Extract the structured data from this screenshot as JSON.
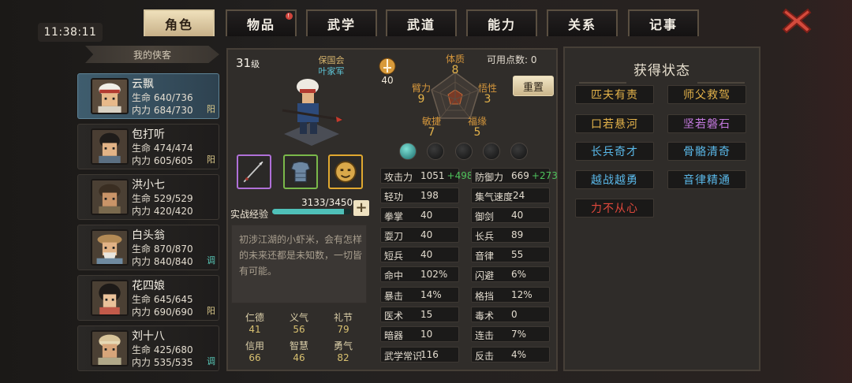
{
  "clock": "11:38:11",
  "tabs": [
    {
      "label": "角色",
      "active": true
    },
    {
      "label": "物品",
      "badge": "!"
    },
    {
      "label": "武学"
    },
    {
      "label": "武道"
    },
    {
      "label": "能力"
    },
    {
      "label": "关系"
    },
    {
      "label": "记事"
    }
  ],
  "roster_title": "我的侠客",
  "heroes": [
    {
      "name": "云飘",
      "hp": "生命 640/736",
      "mp": "内力 684/730",
      "tag": "阳",
      "selected": true
    },
    {
      "name": "包打听",
      "hp": "生命 474/474",
      "mp": "内力 605/605",
      "tag": "阳"
    },
    {
      "name": "洪小七",
      "hp": "生命 529/529",
      "mp": "内力 420/420",
      "tag": ""
    },
    {
      "name": "白头翁",
      "hp": "生命 870/870",
      "mp": "内力 840/840",
      "tag": "调"
    },
    {
      "name": "花四娘",
      "hp": "生命 645/645",
      "mp": "内力 690/690",
      "tag": "阳"
    },
    {
      "name": "刘十八",
      "hp": "生命 425/680",
      "mp": "内力 535/535",
      "tag": "调"
    }
  ],
  "character": {
    "level": "31",
    "level_unit": "级",
    "faction": "保国会",
    "sub_faction": "叶家军",
    "sword_value": "40",
    "exp_label": "实战经验",
    "exp_value": "3133/3450",
    "exp_fraction": 0.908,
    "description": "初涉江湖的小虾米，会有怎样的未来还都是未知数，一切皆有可能。"
  },
  "attributes": {
    "physique": {
      "label": "体质",
      "value": "8"
    },
    "arm": {
      "label": "臂力",
      "value": "9"
    },
    "nature": {
      "label": "悟性",
      "value": "3"
    },
    "agility": {
      "label": "敏捷",
      "value": "7"
    },
    "fortune": {
      "label": "福缘",
      "value": "5"
    }
  },
  "points_label": "可用点数: 0",
  "reset_label": "重置",
  "virtues": [
    {
      "label": "仁德",
      "value": "41"
    },
    {
      "label": "义气",
      "value": "56"
    },
    {
      "label": "礼节",
      "value": "79"
    },
    {
      "label": "信用",
      "value": "66"
    },
    {
      "label": "智慧",
      "value": "46"
    },
    {
      "label": "勇气",
      "value": "82"
    }
  ],
  "stats_left": [
    {
      "label": "攻击力",
      "value": "1051",
      "bonus": "+498"
    },
    {
      "label": "轻功",
      "value": "198"
    },
    {
      "label": "拳掌",
      "value": "40"
    },
    {
      "label": "耍刀",
      "value": "40"
    },
    {
      "label": "短兵",
      "value": "40"
    },
    {
      "label": "命中",
      "value": "102%"
    },
    {
      "label": "暴击",
      "value": "14%"
    },
    {
      "label": "医术",
      "value": "15"
    },
    {
      "label": "暗器",
      "value": "10"
    },
    {
      "label": "武学常识",
      "value": "116"
    }
  ],
  "stats_right": [
    {
      "label": "防御力",
      "value": "669",
      "bonus": "+273"
    },
    {
      "label": "集气速度",
      "value": "24"
    },
    {
      "label": "御剑",
      "value": "40"
    },
    {
      "label": "长兵",
      "value": "89"
    },
    {
      "label": "音律",
      "value": "55"
    },
    {
      "label": "闪避",
      "value": "6%"
    },
    {
      "label": "格挡",
      "value": "12%"
    },
    {
      "label": "毒术",
      "value": "0"
    },
    {
      "label": "连击",
      "value": "7%"
    },
    {
      "label": "反击",
      "value": "4%"
    }
  ],
  "status_title": "获得状态",
  "statuses": [
    {
      "label": "匹夫有责",
      "color": "#e3b24a"
    },
    {
      "label": "师父救驾",
      "color": "#e3b24a"
    },
    {
      "label": "口若悬河",
      "color": "#e3b24a"
    },
    {
      "label": "坚若磐石",
      "color": "#c57ae0"
    },
    {
      "label": "长兵奇才",
      "color": "#5ab8e8"
    },
    {
      "label": "骨骼清奇",
      "color": "#5ab8e8"
    },
    {
      "label": "越战越勇",
      "color": "#5ab8e8"
    },
    {
      "label": "音律精通",
      "color": "#5ab8e8"
    },
    {
      "label": "力不从心",
      "color": "#e0483c"
    }
  ],
  "colors": {
    "accent": "#e3b24a",
    "teal": "#4fc0b8",
    "bonus": "#4ec25b"
  }
}
